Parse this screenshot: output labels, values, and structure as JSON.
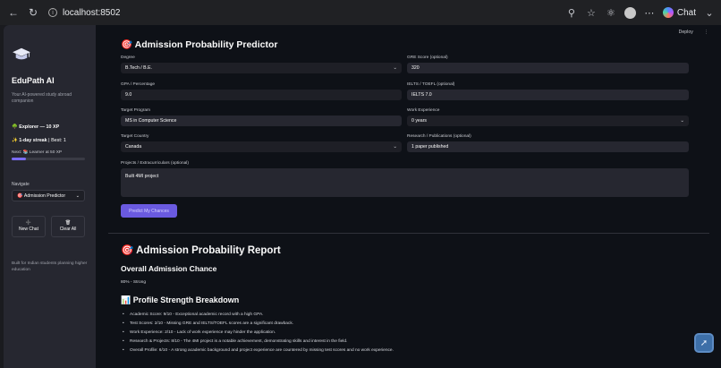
{
  "browser": {
    "url": "localhost:8502",
    "chat_label": "Chat"
  },
  "sidebar": {
    "brand": "EduPath AI",
    "tagline": "Your AI-powered study abroad companion",
    "xp_text": "Explorer — 10 XP",
    "streak_text": "1-day streak",
    "streak_best": " | Best: 1",
    "next_text": "Next: 📚 Learner at 50 XP",
    "progress_fraction": 0.2,
    "navigate_label": "Navigate",
    "navigate_selected": "Admission Predictor",
    "new_chat_label": "New Chat",
    "clear_all_label": "Clear All",
    "footer": "Built for Indian students planning higher education"
  },
  "main": {
    "deploy_label": "Deploy",
    "title": "Admission Probability Predictor",
    "form": {
      "degree_label": "Degree",
      "degree_value": "B.Tech / B.E.",
      "gre_label": "GRE Score (optional)",
      "gre_value": "320",
      "gpa_label": "GPA / Percentage",
      "gpa_value": "9.0",
      "ielts_label": "IELTS / TOEFL (optional)",
      "ielts_value": "IELTS 7.0",
      "program_label": "Target Program",
      "program_value": "MS in Computer Science",
      "work_label": "Work Experience",
      "work_value": "0 years",
      "country_label": "Target Country",
      "country_value": "Canada",
      "research_label": "Research / Publications (optional)",
      "research_value": "1 paper published",
      "projects_label": "Projects / Extracurriculars (optional)",
      "projects_value": "Built 4MI project",
      "submit_label": "Predict My Chances"
    },
    "report": {
      "title": "Admission Probability Report",
      "overall_title": "Overall Admission Chance",
      "overall_value": "80% - Strong",
      "breakdown_title": "Profile Strength Breakdown",
      "bullets": [
        "Academic Score: 9/10 - Exceptional academic record with a high GPA.",
        "Test Scores: 2/10 - Missing GRE and IELTS/TOEFL scores are a significant drawback.",
        "Work Experience: 2/10 - Lack of work experience may hinder the application.",
        "Research & Projects: 8/10 - The 4MI project is a notable achievement, demonstrating skills and interest in the field.",
        "Overall Profile: 6/10 - A strong academic background and project experience are countered by missing test scores and no work experience."
      ]
    }
  },
  "colors": {
    "accent": "#6a5ae0",
    "sidebar_bg": "#262730",
    "main_bg": "#0e1117"
  }
}
